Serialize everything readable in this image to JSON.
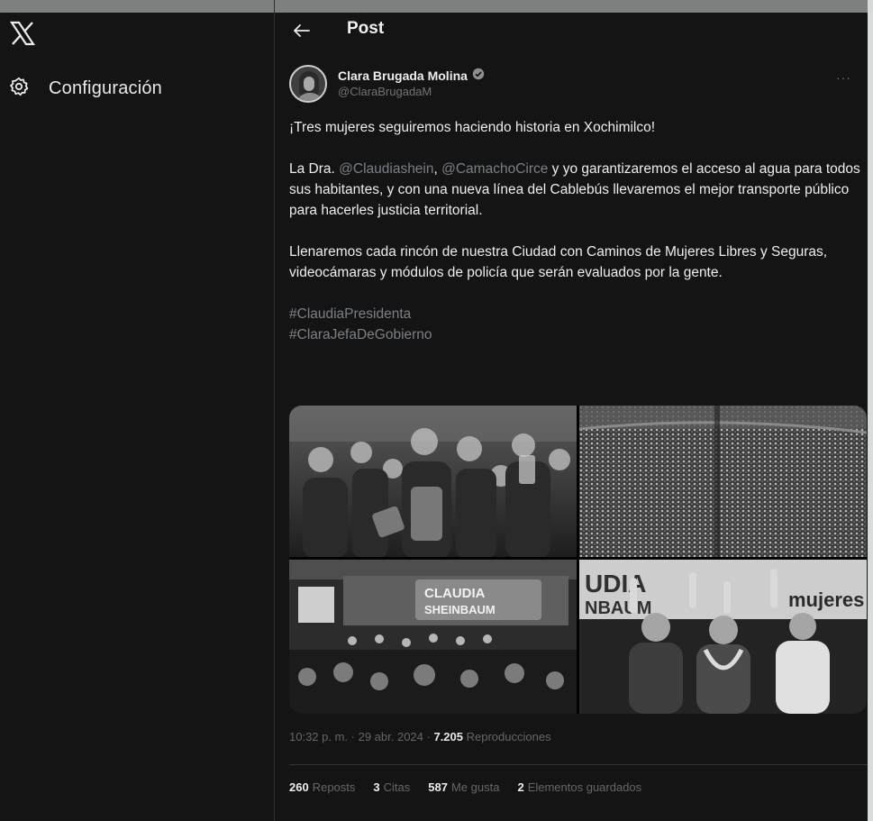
{
  "sidebar": {
    "logo_icon": "x-logo-icon",
    "items": [
      {
        "icon": "gear-icon",
        "label": "Configuración"
      }
    ]
  },
  "header": {
    "back_icon": "arrow-left-icon",
    "title": "Post"
  },
  "post": {
    "author": {
      "name": "Clara Brugada Molina",
      "verified_icon": "verified-badge-icon",
      "handle": "@ClaraBrugadaM"
    },
    "more_label": "···",
    "text": {
      "p1": "¡Tres mujeres seguiremos haciendo historia en Xochimilco!",
      "p2_a": "La Dra. ",
      "p2_mention1": "@Claudiashein",
      "p2_b": ", ",
      "p2_mention2": "@CamachoCirce",
      "p2_c": " y yo garantizaremos el acceso al agua para todos sus habitantes, y con una nueva línea del Cablebús llevaremos el mejor transporte público para hacerles justicia territorial.",
      "p3": "Llenaremos cada rincón de nuestra Ciudad con Caminos de Mujeres Libres y Seguras, videocámaras y módulos de policía que serán evaluados por la gente.",
      "hashtag1": "#ClaudiaPresidenta",
      "hashtag2": "#ClaraJefaDeGobierno"
    },
    "media": {
      "banner_text_1": "CLAUDIA",
      "banner_text_2": "SHEINBAUM",
      "banner_text_3": "UDIA",
      "banner_text_4": "NBAUM",
      "banner_text_5": "mujeres"
    },
    "meta": {
      "time": "10:32 p. m.",
      "sep1": " · ",
      "date": "29 abr. 2024",
      "sep2": " · ",
      "views": "7.205",
      "views_label": " Reproducciones"
    },
    "stats": {
      "reposts_num": "260",
      "reposts_label": "Reposts",
      "quotes_num": "3",
      "quotes_label": "Citas",
      "likes_num": "587",
      "likes_label": "Me gusta",
      "saves_num": "2",
      "saves_label": "Elementos guardados"
    }
  },
  "colors": {
    "background": "#141414",
    "text": "#e7e9ea",
    "muted": "#6f7478"
  }
}
